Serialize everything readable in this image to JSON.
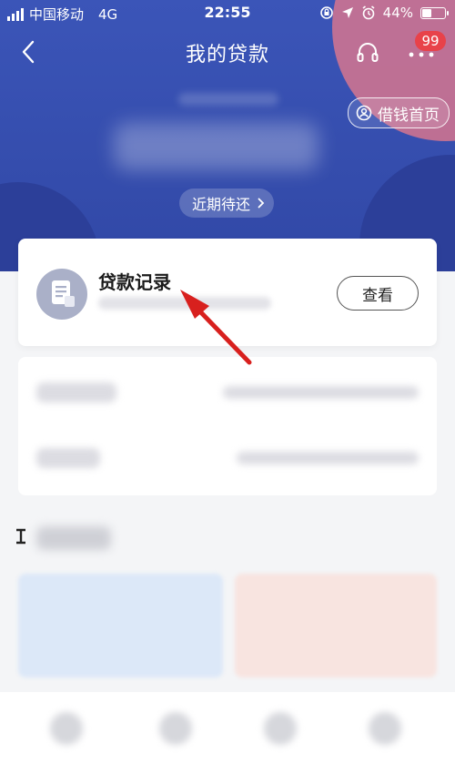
{
  "status_bar": {
    "carrier": "中国移动",
    "network": "4G",
    "time": "22:55",
    "battery": "44%",
    "battery_level": 0.44
  },
  "nav": {
    "title": "我的贷款",
    "badge_count": "99"
  },
  "header": {
    "borrow_home_label": "借钱首页",
    "recent_due_label": "近期待还"
  },
  "loan_record": {
    "title": "贷款记录",
    "view_button_label": "查看"
  },
  "colors": {
    "header_blue": "#3b55b8",
    "badge_red": "#e8424a",
    "annotation_arrow_red": "#d8201e"
  },
  "icons": [
    "back-icon",
    "headset-icon",
    "more-icon",
    "borrow-home-icon",
    "chevron-right-icon",
    "document-icon",
    "location-arrow-icon",
    "alarm-icon",
    "lock-rotation-icon"
  ]
}
